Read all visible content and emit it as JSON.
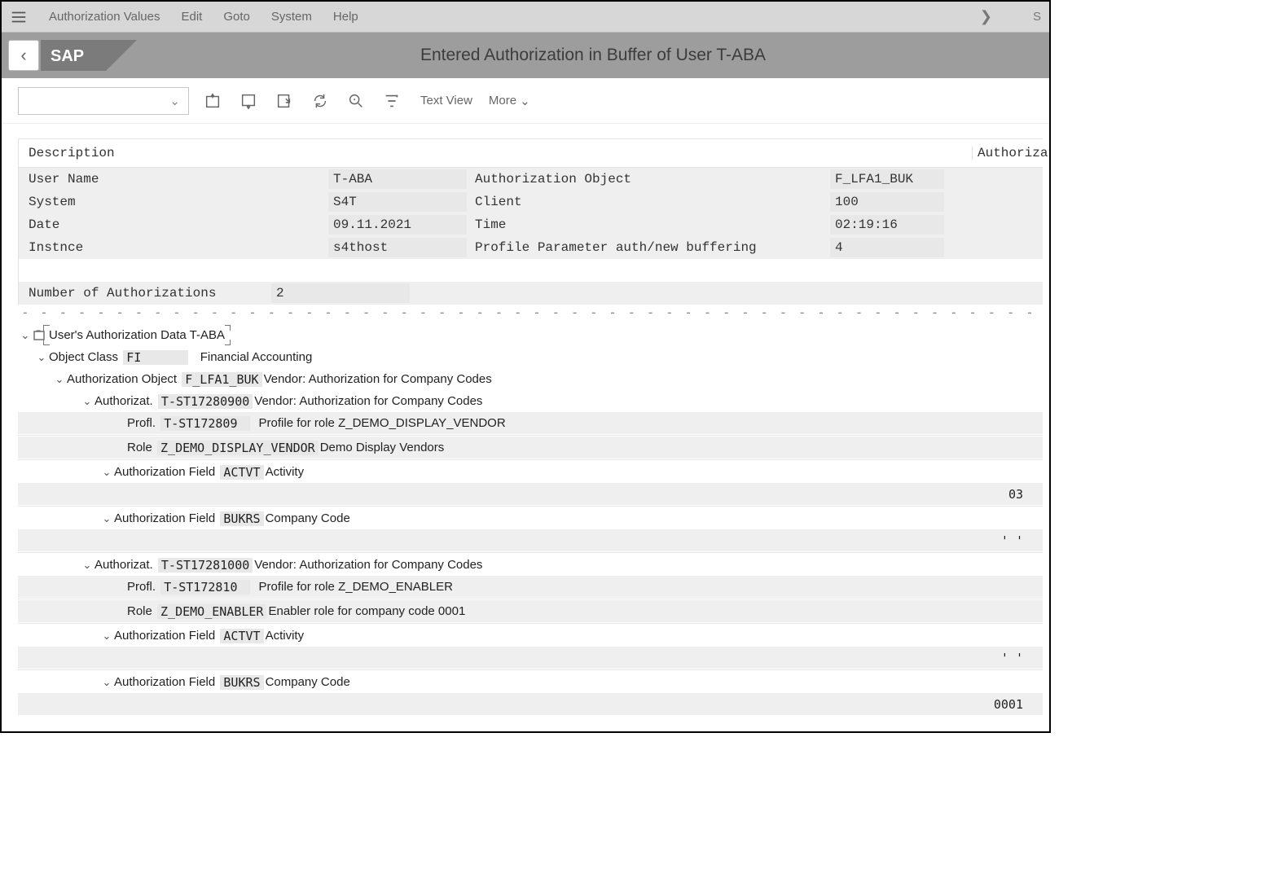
{
  "menu": {
    "items": [
      "Authorization Values",
      "Edit",
      "Goto",
      "System",
      "Help"
    ],
    "overflow_letter": "S"
  },
  "header": {
    "page_title": "Entered Authorization in Buffer of User T-ABA"
  },
  "toolbar": {
    "text_view": "Text View",
    "more": "More"
  },
  "columns": {
    "description": "Description",
    "authorization": "Authorizati"
  },
  "info": {
    "rows": [
      {
        "l1": "User Name",
        "v1": "T-ABA",
        "l2": "Authorization Object",
        "v2": "F_LFA1_BUK"
      },
      {
        "l1": "System",
        "v1": "S4T",
        "l2": "Client",
        "v2": "100"
      },
      {
        "l1": "Date",
        "v1": "09.11.2021",
        "l2": "Time",
        "v2": "02:19:16"
      },
      {
        "l1": "Instnce",
        "v1": "s4thost",
        "l2": "Profile Parameter auth/new buffering",
        "v2": "4"
      }
    ],
    "count_label": "Number of Authorizations",
    "count_value": "2"
  },
  "tree": {
    "root_label": "User's Authorization Data T-ABA",
    "object_class": {
      "prefix": "Object Class",
      "code": "FI",
      "desc": "Financial Accounting"
    },
    "auth_object": {
      "prefix": "Authorization Object",
      "code": "F_LFA1_BUK",
      "desc": "Vendor: Authorization for Company Codes"
    },
    "auth1": {
      "prefix": "Authorizat.",
      "code": "T-ST17280900",
      "desc": "Vendor: Authorization for Company Codes",
      "profl_label": "Profl.",
      "profl_code": "T-ST172809",
      "profl_desc": "Profile for role Z_DEMO_DISPLAY_VENDOR",
      "role_label": "Role",
      "role_code": "Z_DEMO_DISPLAY_VENDOR",
      "role_desc": "Demo Display Vendors",
      "field1": {
        "prefix": "Authorization Field",
        "code": "ACTVT",
        "desc": "Activity",
        "value": "03"
      },
      "field2": {
        "prefix": "Authorization Field",
        "code": "BUKRS",
        "desc": "Company Code",
        "value": "'  '"
      }
    },
    "auth2": {
      "prefix": "Authorizat.",
      "code": "T-ST17281000",
      "desc": "Vendor: Authorization for Company Codes",
      "profl_label": "Profl.",
      "profl_code": "T-ST172810",
      "profl_desc": "Profile for role Z_DEMO_ENABLER",
      "role_label": "Role",
      "role_code": "Z_DEMO_ENABLER",
      "role_desc": "Enabler role for company code 0001",
      "field1": {
        "prefix": "Authorization Field",
        "code": "ACTVT",
        "desc": "Activity",
        "value": "'  '"
      },
      "field2": {
        "prefix": "Authorization Field",
        "code": "BUKRS",
        "desc": "Company Code",
        "value": "0001"
      }
    }
  }
}
